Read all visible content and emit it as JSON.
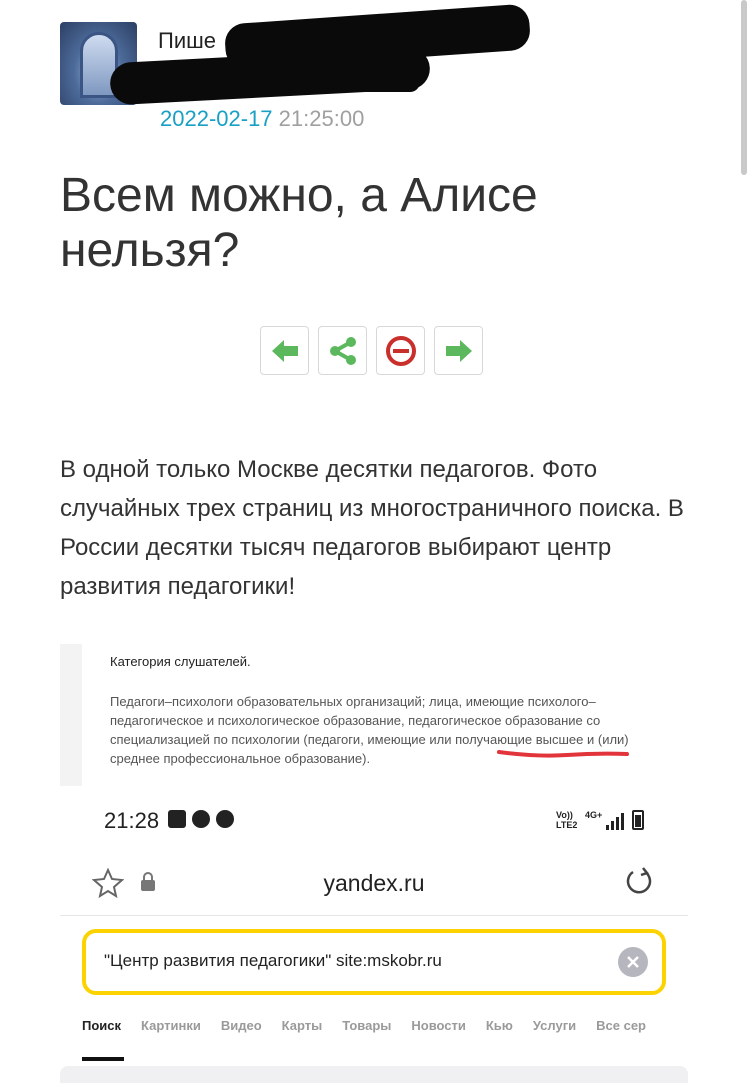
{
  "post": {
    "author_label": "Пише",
    "date": "2022-02-17",
    "time": "21:25:00",
    "title": "Всем можно, а Алисе нельзя?",
    "body": "В одной только Москве десятки педагогов. Фото случайных трех страниц из многостраничного поиска. В России десятки тысяч педагогов выбирают центр развития педагогики!",
    "actions": [
      {
        "icon": "arrow-left-icon",
        "color": "#5cb85c"
      },
      {
        "icon": "share-icon",
        "color": "#5cb85c"
      },
      {
        "icon": "block-icon",
        "color": "#c9302c"
      },
      {
        "icon": "arrow-right-icon",
        "color": "#5cb85c"
      }
    ]
  },
  "embedded_doc": {
    "category_heading": "Категория слушателей.",
    "description": "Педагоги–психологи образовательных организаций; лица, имеющие психолого–педагогическое и психологическое образование, педагогическое образование со специализацией по психологии (педагоги, имеющие или получающие высшее и (или) среднее профессиональное образование)."
  },
  "phone": {
    "time": "21:28",
    "network_line1": "Vo))",
    "network_line2": "LTE2",
    "network_gen": "4G+",
    "url": "yandex.ru",
    "search_query": "\"Центр развития педагогики\" site:mskobr.ru",
    "tabs": [
      "Поиск",
      "Картинки",
      "Видео",
      "Карты",
      "Товары",
      "Новости",
      "Кью",
      "Услуги",
      "Все сер"
    ],
    "accent_color": "#fcd300"
  }
}
